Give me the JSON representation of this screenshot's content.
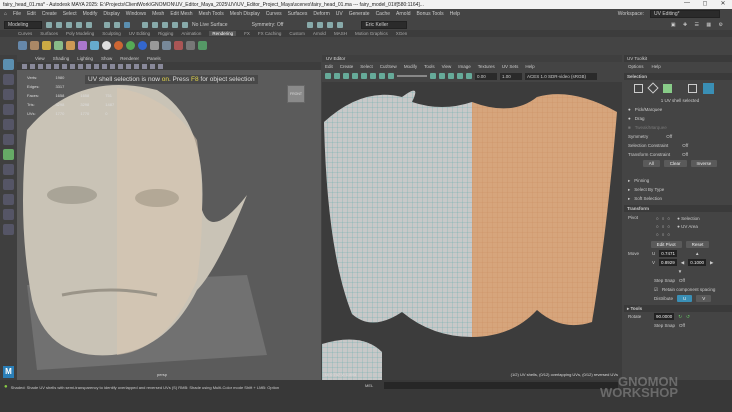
{
  "window": {
    "title": "fairy_head_01.ma* - Autodesk MAYA 2025: E:\\Projects\\ClientWork\\GNOMON\\UV_Editor_Maya_2025\\UV\\UV_Editor_Project_Maya\\scenes\\fairy_head_01.ma  ---  fairy_model_01\\f[580:1164]...",
    "controls": [
      "—",
      "◻",
      "✕"
    ]
  },
  "menubar": [
    "File",
    "Edit",
    "Create",
    "Select",
    "Modify",
    "Display",
    "Windows",
    "Mesh",
    "Edit Mesh",
    "Mesh Tools",
    "Mesh Display",
    "Curves",
    "Surfaces",
    "Deform",
    "UV",
    "Generate",
    "Cache",
    "Arnold",
    "Bonus Tools",
    "Help"
  ],
  "toolbar": {
    "mode": "Modeling",
    "live_surface": "No Live Surface",
    "symmetry": "Symmetry: Off",
    "user": "Eric Keller",
    "workspace_label": "Workspace:",
    "workspace": "UV Editing*"
  },
  "shelf_tabs": [
    "Curves",
    "Surfaces",
    "Poly Modeling",
    "Sculpting",
    "UV Editing",
    "Rigging",
    "Animation",
    "Rendering",
    "FX",
    "FX Caching",
    "Custom",
    "Arnold",
    "MASH",
    "Motion Graphics",
    "XGen"
  ],
  "shelf_active": "Rendering",
  "viewport": {
    "menu": [
      "View",
      "Shading",
      "Lighting",
      "Show",
      "Renderer",
      "Panels"
    ],
    "hud": [
      [
        "Verts:",
        "1980",
        "",
        ""
      ],
      [
        "Edges:",
        "3317",
        "",
        ""
      ],
      [
        "Faces:",
        "1658",
        "1658",
        "751"
      ],
      [
        "Tris:",
        "3298",
        "3298",
        "1487"
      ],
      [
        "UVs:",
        "1770",
        "1770",
        "0"
      ]
    ],
    "message_pre": "UV shell selection is now ",
    "message_on": "on",
    "message_mid": ". Press ",
    "message_key": "F8",
    "message_post": " for object selection",
    "cube_label": "FRONT",
    "camera": "persp"
  },
  "uv_editor": {
    "title": "UV Editor",
    "menu": [
      "Edit",
      "Create",
      "Select",
      "Cut/Sew",
      "Modify",
      "Tools",
      "View",
      "Image",
      "Textures",
      "UV Sets",
      "Help"
    ],
    "exposure": "0.00",
    "gamma": "1.00",
    "color_space": "ACES 1.0 SDR-video (sRGB)",
    "coords": "U: 0.747  V: 0.893",
    "info": "(1/2) UV shells, (0/12) overlapping UVs, (0/12) reversed UVs"
  },
  "toolkit": {
    "title": "UV Toolkit",
    "menu": [
      "Options",
      "Help"
    ],
    "selection": "Selection",
    "selected_text": "1 UV shell selected",
    "modes": [
      "Pick/Marquee",
      "Drag",
      "Tweak/Marquee"
    ],
    "symmetry_label": "Symmetry",
    "symmetry": "Off",
    "sel_constraint_label": "Selection Constraint",
    "sel_constraint": "Off",
    "tr_constraint_label": "Transform Constraint",
    "tr_constraint": "Off",
    "buttons": [
      "All",
      "Clear",
      "Inverse"
    ],
    "sections": [
      "Pinning",
      "Select By Type",
      "Soft Selection"
    ],
    "transform": "Transform",
    "pivot": "Pivot",
    "pivot_opts": [
      "Selection",
      "UV Area"
    ],
    "edit_pivot": "Edit Pivot",
    "reset": "Reset",
    "move": "Move",
    "u_label": "U",
    "u": "0.7471",
    "v_label": "V",
    "v": "0.8929",
    "step": "0.1000",
    "step_snap": "Step Snap",
    "step_snap_val": "Off",
    "retain": "Retain component spacing",
    "distribute": "Distribute",
    "du": "U",
    "dv": "V",
    "tools": "Tools",
    "rotate": "Rotate",
    "rotate_val": "90.0000",
    "step_snap2": "Step Snap",
    "step_snap2_val": "Off"
  },
  "help_line": "Shaded: Shade UV shells with semi-transparency to identify overlapped and reversed UVs (S) RMB: Shade using Multi-Color mode Shift + LMB: Option",
  "mel_label": "MEL",
  "watermark": [
    "GNOMON",
    "WORKSHOP"
  ],
  "logo": "M"
}
